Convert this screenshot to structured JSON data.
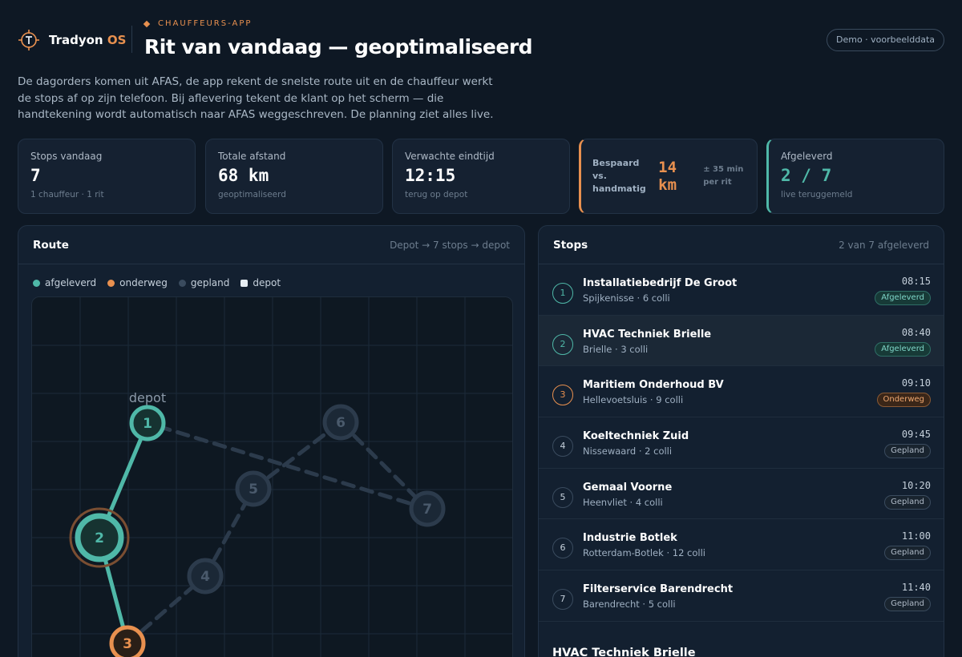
{
  "brand": {
    "name": "Tradyon",
    "suffix": "OS",
    "logo_icon": "compass-logo-icon"
  },
  "header": {
    "eyebrow": "CHAUFFEURS-APP",
    "title": "Rit van vandaag — geoptimaliseerd",
    "demo_pill": "Demo · voorbeelddata"
  },
  "intro": "De dagorders komen uit AFAS, de app rekent de snelste route uit en de chauffeur werkt de stops af op zijn telefoon. Bij aflevering tekent de klant op het scherm — die handtekening wordt automatisch naar AFAS weggeschreven. De planning ziet alles live.",
  "kpis": {
    "stops": {
      "label": "Stops vandaag",
      "value": "7",
      "sub": "1 chauffeur · 1 rit"
    },
    "distance": {
      "label": "Totale afstand",
      "value": "68 km",
      "sub": "geoptimaliseerd"
    },
    "end_time": {
      "label": "Verwachte eindtijd",
      "value": "12:15",
      "sub": "terug op depot"
    },
    "saved": {
      "label": "Bespaard vs. handmatig",
      "value": "14 km",
      "note": "± 35 min per rit"
    },
    "delivered": {
      "label": "Afgeleverd",
      "value": "2 / 7",
      "sub": "live teruggemeld"
    }
  },
  "route_panel": {
    "title": "Route",
    "meta": "Depot → 7 stops → depot",
    "legend": [
      {
        "label": "afgeleverd",
        "color": "#4fb8a8"
      },
      {
        "label": "onderweg",
        "color": "#e8904f"
      },
      {
        "label": "gepland",
        "color": "#3a4b5e"
      },
      {
        "label": "depot",
        "color": "#e6edf3"
      }
    ],
    "depot_label": "depot"
  },
  "stops_panel": {
    "title": "Stops",
    "meta": "2 van 7 afgeleverd",
    "stops": [
      {
        "num": "1",
        "name": "Installatiebedrijf De Groot",
        "sub": "Spijkenisse · 6 colli",
        "time": "08:15",
        "status": "Afgeleverd",
        "state": "delivered"
      },
      {
        "num": "2",
        "name": "HVAC Techniek Brielle",
        "sub": "Brielle · 3 colli",
        "time": "08:40",
        "status": "Afgeleverd",
        "state": "delivered"
      },
      {
        "num": "3",
        "name": "Maritiem Onderhoud BV",
        "sub": "Hellevoetsluis · 9 colli",
        "time": "09:10",
        "status": "Onderweg",
        "state": "onderweg"
      },
      {
        "num": "4",
        "name": "Koeltechniek Zuid",
        "sub": "Nissewaard · 2 colli",
        "time": "09:45",
        "status": "Gepland",
        "state": "gepland"
      },
      {
        "num": "5",
        "name": "Gemaal Voorne",
        "sub": "Heenvliet · 4 colli",
        "time": "10:20",
        "status": "Gepland",
        "state": "gepland"
      },
      {
        "num": "6",
        "name": "Industrie Botlek",
        "sub": "Rotterdam-Botlek · 12 colli",
        "time": "11:00",
        "status": "Gepland",
        "state": "gepland"
      },
      {
        "num": "7",
        "name": "Filterservice Barendrecht",
        "sub": "Barendrecht · 5 colli",
        "time": "11:40",
        "status": "Gepland",
        "state": "gepland"
      }
    ],
    "detail_title": "HVAC Techniek Brielle"
  },
  "colors": {
    "accent": "#e8904f",
    "delivered": "#4fb8a8",
    "planned": "#3a4b5e",
    "background": "#0e1824"
  }
}
